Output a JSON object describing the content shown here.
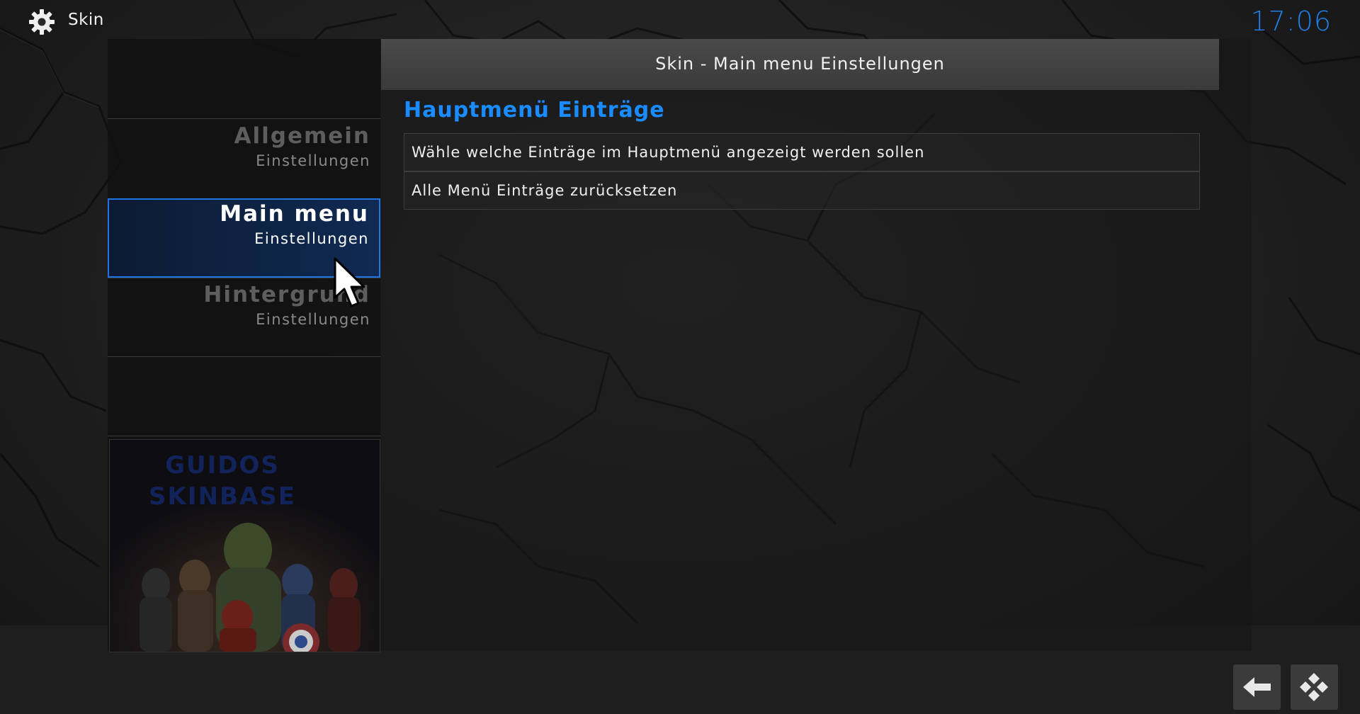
{
  "topbar": {
    "title": "Skin",
    "icon": "gear-icon",
    "clock": "17:06"
  },
  "header": {
    "title": "Skin - Main menu Einstellungen"
  },
  "sidebar": {
    "items": [
      {
        "label": "Allgemein",
        "sub": "Einstellungen"
      },
      {
        "label": "Main menu",
        "sub": "Einstellungen",
        "active": true
      },
      {
        "label": "Hintergrund",
        "sub": "Einstellungen"
      }
    ],
    "promo": {
      "title_line1": "GUIDOS",
      "title_line2": "SKINBASE"
    }
  },
  "content": {
    "section_title": "Hauptmenü Einträge",
    "rows": [
      "Wähle welche Einträge im Hauptmenü angezeigt werden sollen",
      "Alle Menü Einträge zurücksetzen"
    ]
  },
  "bottom": {
    "back_icon": "back-arrow-icon",
    "kodi_icon": "kodi-logo-icon"
  },
  "colors": {
    "accent": "#1e74e0",
    "clock": "#1e7ee6",
    "section_title": "#1a8cff"
  }
}
